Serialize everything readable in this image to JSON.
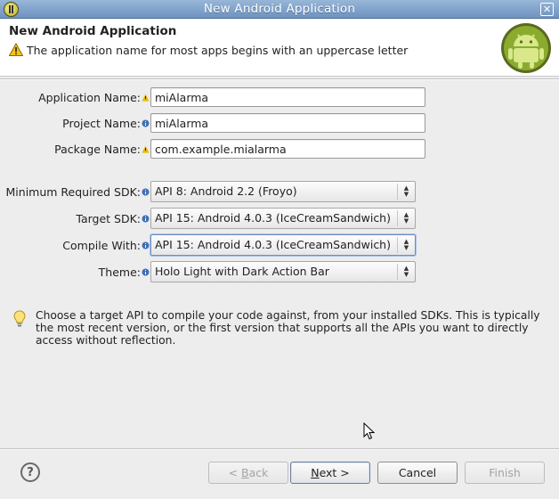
{
  "window": {
    "title": "New Android Application",
    "close_glyph": "✕"
  },
  "header": {
    "heading": "New Android Application",
    "message": "The application name for most apps begins with an uppercase letter",
    "message_icon": "warning-icon",
    "logo_icon": "android-logo-icon"
  },
  "fields": {
    "app_name": {
      "label": "Application Name:",
      "value": "miAlarma"
    },
    "project_name": {
      "label": "Project Name:",
      "value": "miAlarma"
    },
    "package_name": {
      "label": "Package Name:",
      "value": "com.example.mialarma"
    }
  },
  "selects": {
    "min_sdk": {
      "label": "Minimum Required SDK:",
      "value": "API 8: Android 2.2 (Froyo)"
    },
    "target_sdk": {
      "label": "Target SDK:",
      "value": "API 15: Android 4.0.3 (IceCreamSandwich)"
    },
    "compile_with": {
      "label": "Compile With:",
      "value": "API 15: Android 4.0.3 (IceCreamSandwich)"
    },
    "theme": {
      "label": "Theme:",
      "value": "Holo Light with Dark Action Bar"
    }
  },
  "info": {
    "icon": "lightbulb-icon",
    "text": "Choose a target API to compile your code against, from your installed SDKs. This is typically the most recent version, or the first version that supports all the APIs you want to directly access without reflection."
  },
  "footer": {
    "help_glyph": "?",
    "back": {
      "mnemonic": "B",
      "rest": "ack",
      "prefix": "< ",
      "enabled": false
    },
    "next": {
      "mnemonic": "N",
      "rest": "ext >",
      "enabled": true
    },
    "cancel": "Cancel",
    "finish": "Finish"
  },
  "colors": {
    "titlebar": "#7fa2cc",
    "window_bg": "#ededed",
    "warning": "#e8b600",
    "info_decoration": "#3f6fb6",
    "android_green": "#a4c639"
  }
}
